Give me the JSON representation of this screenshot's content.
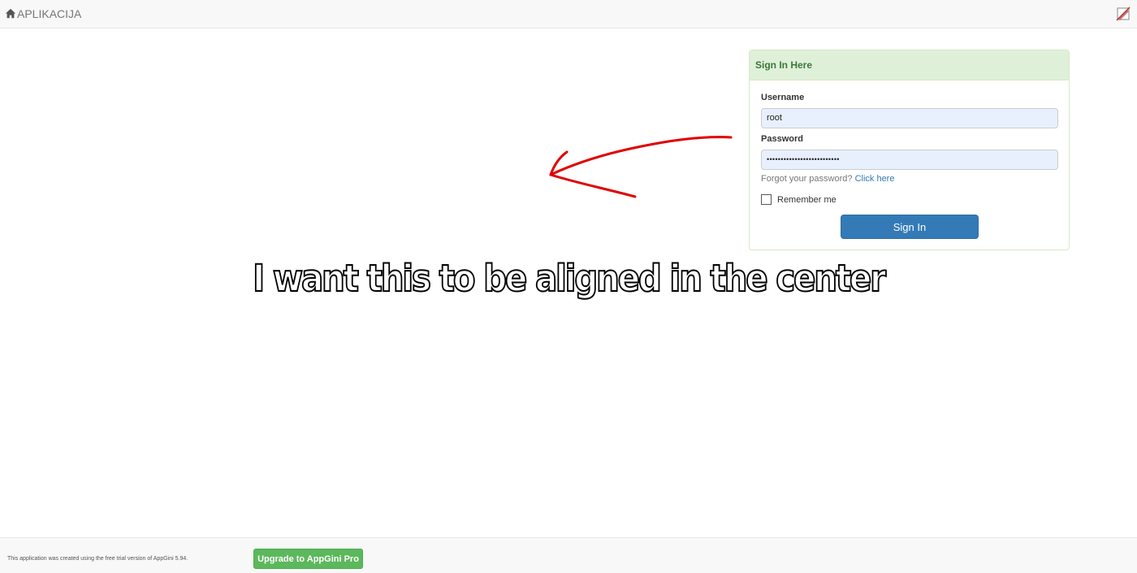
{
  "navbar": {
    "brand_label": "APLIKACIJA",
    "home_icon": "home-icon",
    "logout_icon": "logout-icon"
  },
  "login": {
    "heading": "Sign In Here",
    "username_label": "Username",
    "username_value": "root",
    "password_label": "Password",
    "password_mask": "••••••••••••••••••••••••••",
    "forgot_text": "Forgot your password?",
    "forgot_link": "Click here",
    "remember_label": "Remember me",
    "remember_checked": false,
    "submit_label": "Sign In"
  },
  "annotation": {
    "text": "I want this to be aligned in the center",
    "arrow_color": "#e00000"
  },
  "footer": {
    "text": "This application was created using the free trial version of AppGini 5.94.",
    "upgrade_label": "Upgrade to AppGini Pro"
  },
  "colors": {
    "panel_heading_bg": "#dff0d8",
    "panel_heading_text": "#3c763d",
    "primary": "#337ab7",
    "success": "#5cb85c",
    "link": "#337ab7"
  }
}
